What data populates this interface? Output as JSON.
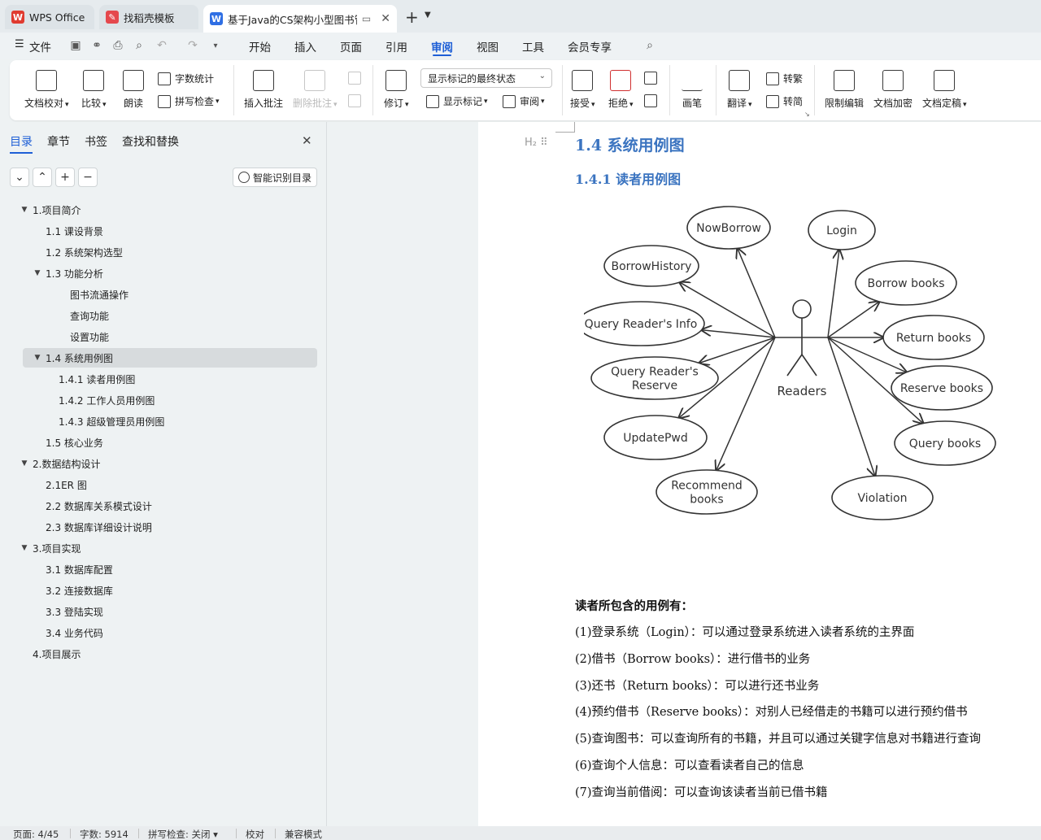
{
  "tabs": [
    {
      "label": "WPS Office",
      "color": "#e03b30"
    },
    {
      "label": "找稻壳模板",
      "color": "#e5484d"
    },
    {
      "label": "基于Java的CS架构小型图书管理系统",
      "color": "#2f6fe4"
    }
  ],
  "menu": {
    "file": "文件",
    "items": [
      "开始",
      "插入",
      "页面",
      "引用",
      "审阅",
      "视图",
      "工具",
      "会员专享"
    ],
    "active": "审阅"
  },
  "ribbon": {
    "doc_check": "文档校对",
    "compare": "比较",
    "read_aloud": "朗读",
    "word_count": "字数统计",
    "spell_check": "拼写检查",
    "insert_comment": "插入批注",
    "delete_comment": "删除批注",
    "revise": "修订",
    "mark_state": "显示标记的最终状态",
    "show_marks": "显示标记",
    "review": "审阅",
    "accept": "接受",
    "reject": "拒绝",
    "pen": "画笔",
    "translate": "翻译",
    "to_traditional": "转繁",
    "to_simplified": "转简",
    "restrict_edit": "限制编辑",
    "encrypt": "文档加密",
    "finalize": "文档定稿"
  },
  "nav": {
    "tabs": [
      "目录",
      "章节",
      "书签",
      "查找和替换"
    ],
    "smart_toc": "智能识别目录",
    "toc": [
      {
        "label": "1.项目简介",
        "level": 0,
        "caret": "▼"
      },
      {
        "label": "1.1 课设背景",
        "level": 1,
        "caret": ""
      },
      {
        "label": "1.2 系统架构选型",
        "level": 1,
        "caret": ""
      },
      {
        "label": "1.3 功能分析",
        "level": 1,
        "caret": "▼"
      },
      {
        "label": "图书流通操作",
        "level": 3,
        "caret": ""
      },
      {
        "label": "查询功能",
        "level": 3,
        "caret": ""
      },
      {
        "label": "设置功能",
        "level": 3,
        "caret": ""
      },
      {
        "label": "1.4 系统用例图",
        "level": 1,
        "caret": "▼",
        "selected": true
      },
      {
        "label": "1.4.1 读者用例图",
        "level": 2,
        "caret": ""
      },
      {
        "label": "1.4.2 工作人员用例图",
        "level": 2,
        "caret": ""
      },
      {
        "label": "1.4.3 超级管理员用例图",
        "level": 2,
        "caret": ""
      },
      {
        "label": "1.5 核心业务",
        "level": 1,
        "caret": ""
      },
      {
        "label": "2.数据结构设计",
        "level": 0,
        "caret": "▼"
      },
      {
        "label": "2.1ER 图",
        "level": 1,
        "caret": ""
      },
      {
        "label": "2.2 数据库关系模式设计",
        "level": 1,
        "caret": ""
      },
      {
        "label": "2.3 数据库详细设计说明",
        "level": 1,
        "caret": ""
      },
      {
        "label": "3.项目实现",
        "level": 0,
        "caret": "▼"
      },
      {
        "label": "3.1 数据库配置",
        "level": 1,
        "caret": ""
      },
      {
        "label": "3.2 连接数据库",
        "level": 1,
        "caret": ""
      },
      {
        "label": "3.3 登陆实现",
        "level": 1,
        "caret": ""
      },
      {
        "label": "3.4 业务代码",
        "level": 1,
        "caret": ""
      },
      {
        "label": "4.项目展示",
        "level": 0,
        "caret": ""
      }
    ]
  },
  "doc": {
    "h1": "1.4 系统用例图",
    "h2": "1.4.1 读者用例图",
    "heading_marker": "H₂",
    "diagram": {
      "actor": "Readers",
      "left_cases": [
        "NowBorrow",
        "BorrowHistory",
        "Query Reader's Info",
        "Query Reader's|Reserve",
        "UpdatePwd",
        "Recommend|books"
      ],
      "right_cases": [
        "Login",
        "Borrow books",
        "Return books",
        "Reserve books",
        "Query books",
        "Violation"
      ]
    },
    "intro": "读者所包含的用例有：",
    "items": [
      "(1)登录系统（Login）：可以通过登录系统进入读者系统的主界面",
      "(2)借书（Borrow books）：进行借书的业务",
      "(3)还书（Return books）：可以进行还书业务",
      "(4)预约借书（Reserve books）：对别人已经借走的书籍可以进行预约借书",
      "(5)查询图书：可以查询所有的书籍，并且可以通过关键字信息对书籍进行查询",
      "(6)查询个人信息：可以查看读者自己的信息",
      "(7)查询当前借阅：可以查询该读者当前已借书籍"
    ]
  },
  "status": {
    "page": "页面: 4/45",
    "words": "字数: 5914",
    "spell": "拼写检查: 关闭",
    "proof": "校对",
    "compat": "兼容模式"
  }
}
